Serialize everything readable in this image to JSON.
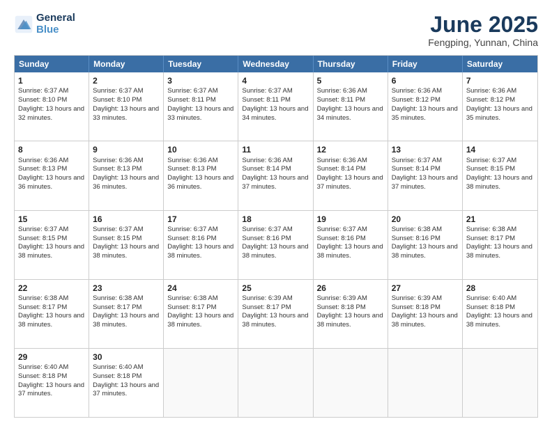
{
  "logo": {
    "line1": "General",
    "line2": "Blue"
  },
  "title": "June 2025",
  "location": "Fengping, Yunnan, China",
  "header_days": [
    "Sunday",
    "Monday",
    "Tuesday",
    "Wednesday",
    "Thursday",
    "Friday",
    "Saturday"
  ],
  "rows": [
    [
      {
        "day": "1",
        "sunrise": "6:37 AM",
        "sunset": "8:10 PM",
        "daylight": "13 hours and 32 minutes."
      },
      {
        "day": "2",
        "sunrise": "6:37 AM",
        "sunset": "8:10 PM",
        "daylight": "13 hours and 33 minutes."
      },
      {
        "day": "3",
        "sunrise": "6:37 AM",
        "sunset": "8:11 PM",
        "daylight": "13 hours and 33 minutes."
      },
      {
        "day": "4",
        "sunrise": "6:37 AM",
        "sunset": "8:11 PM",
        "daylight": "13 hours and 34 minutes."
      },
      {
        "day": "5",
        "sunrise": "6:36 AM",
        "sunset": "8:11 PM",
        "daylight": "13 hours and 34 minutes."
      },
      {
        "day": "6",
        "sunrise": "6:36 AM",
        "sunset": "8:12 PM",
        "daylight": "13 hours and 35 minutes."
      },
      {
        "day": "7",
        "sunrise": "6:36 AM",
        "sunset": "8:12 PM",
        "daylight": "13 hours and 35 minutes."
      }
    ],
    [
      {
        "day": "8",
        "sunrise": "6:36 AM",
        "sunset": "8:13 PM",
        "daylight": "13 hours and 36 minutes."
      },
      {
        "day": "9",
        "sunrise": "6:36 AM",
        "sunset": "8:13 PM",
        "daylight": "13 hours and 36 minutes."
      },
      {
        "day": "10",
        "sunrise": "6:36 AM",
        "sunset": "8:13 PM",
        "daylight": "13 hours and 36 minutes."
      },
      {
        "day": "11",
        "sunrise": "6:36 AM",
        "sunset": "8:14 PM",
        "daylight": "13 hours and 37 minutes."
      },
      {
        "day": "12",
        "sunrise": "6:36 AM",
        "sunset": "8:14 PM",
        "daylight": "13 hours and 37 minutes."
      },
      {
        "day": "13",
        "sunrise": "6:37 AM",
        "sunset": "8:14 PM",
        "daylight": "13 hours and 37 minutes."
      },
      {
        "day": "14",
        "sunrise": "6:37 AM",
        "sunset": "8:15 PM",
        "daylight": "13 hours and 38 minutes."
      }
    ],
    [
      {
        "day": "15",
        "sunrise": "6:37 AM",
        "sunset": "8:15 PM",
        "daylight": "13 hours and 38 minutes."
      },
      {
        "day": "16",
        "sunrise": "6:37 AM",
        "sunset": "8:15 PM",
        "daylight": "13 hours and 38 minutes."
      },
      {
        "day": "17",
        "sunrise": "6:37 AM",
        "sunset": "8:16 PM",
        "daylight": "13 hours and 38 minutes."
      },
      {
        "day": "18",
        "sunrise": "6:37 AM",
        "sunset": "8:16 PM",
        "daylight": "13 hours and 38 minutes."
      },
      {
        "day": "19",
        "sunrise": "6:37 AM",
        "sunset": "8:16 PM",
        "daylight": "13 hours and 38 minutes."
      },
      {
        "day": "20",
        "sunrise": "6:38 AM",
        "sunset": "8:16 PM",
        "daylight": "13 hours and 38 minutes."
      },
      {
        "day": "21",
        "sunrise": "6:38 AM",
        "sunset": "8:17 PM",
        "daylight": "13 hours and 38 minutes."
      }
    ],
    [
      {
        "day": "22",
        "sunrise": "6:38 AM",
        "sunset": "8:17 PM",
        "daylight": "13 hours and 38 minutes."
      },
      {
        "day": "23",
        "sunrise": "6:38 AM",
        "sunset": "8:17 PM",
        "daylight": "13 hours and 38 minutes."
      },
      {
        "day": "24",
        "sunrise": "6:38 AM",
        "sunset": "8:17 PM",
        "daylight": "13 hours and 38 minutes."
      },
      {
        "day": "25",
        "sunrise": "6:39 AM",
        "sunset": "8:17 PM",
        "daylight": "13 hours and 38 minutes."
      },
      {
        "day": "26",
        "sunrise": "6:39 AM",
        "sunset": "8:18 PM",
        "daylight": "13 hours and 38 minutes."
      },
      {
        "day": "27",
        "sunrise": "6:39 AM",
        "sunset": "8:18 PM",
        "daylight": "13 hours and 38 minutes."
      },
      {
        "day": "28",
        "sunrise": "6:40 AM",
        "sunset": "8:18 PM",
        "daylight": "13 hours and 38 minutes."
      }
    ],
    [
      {
        "day": "29",
        "sunrise": "6:40 AM",
        "sunset": "8:18 PM",
        "daylight": "13 hours and 37 minutes."
      },
      {
        "day": "30",
        "sunrise": "6:40 AM",
        "sunset": "8:18 PM",
        "daylight": "13 hours and 37 minutes."
      },
      null,
      null,
      null,
      null,
      null
    ]
  ]
}
